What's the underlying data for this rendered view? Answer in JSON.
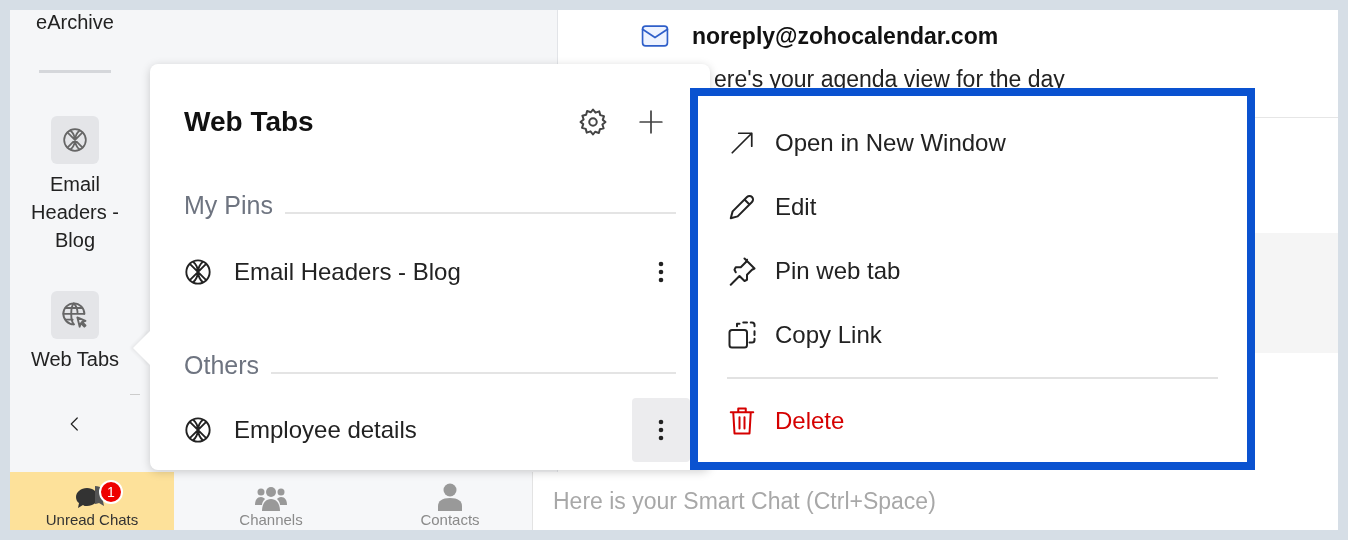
{
  "sidebar": {
    "items": [
      {
        "label": "eArchive",
        "kind": "cut"
      },
      {
        "label": "Email Headers - Blog",
        "kind": "pin"
      },
      {
        "label": "Web Tabs",
        "kind": "webtabs"
      }
    ]
  },
  "mail": {
    "sender": "noreply@zohocalendar.com",
    "preview": "ere's your agenda view for the day"
  },
  "web_tabs_popover": {
    "title": "Web Tabs",
    "sections": [
      {
        "heading": "My Pins",
        "items": [
          {
            "label": "Email Headers - Blog",
            "selected": false
          }
        ]
      },
      {
        "heading": "Others",
        "items": [
          {
            "label": "Employee details",
            "selected": true
          }
        ]
      }
    ]
  },
  "context_menu": {
    "items": [
      {
        "label": "Open in New Window",
        "kind": "open"
      },
      {
        "label": "Edit",
        "kind": "edit"
      },
      {
        "label": "Pin web tab",
        "kind": "pin"
      },
      {
        "label": "Copy Link",
        "kind": "copy"
      },
      {
        "label": "Delete",
        "kind": "delete"
      }
    ]
  },
  "bottom_tabs": [
    {
      "label": "Unread Chats",
      "kind": "chats",
      "selected": true,
      "badge": "1"
    },
    {
      "label": "Channels",
      "kind": "channels",
      "selected": false
    },
    {
      "label": "Contacts",
      "kind": "contacts",
      "selected": false
    }
  ],
  "smart_chat": {
    "placeholder": "Here is your Smart Chat (Ctrl+Space)"
  }
}
